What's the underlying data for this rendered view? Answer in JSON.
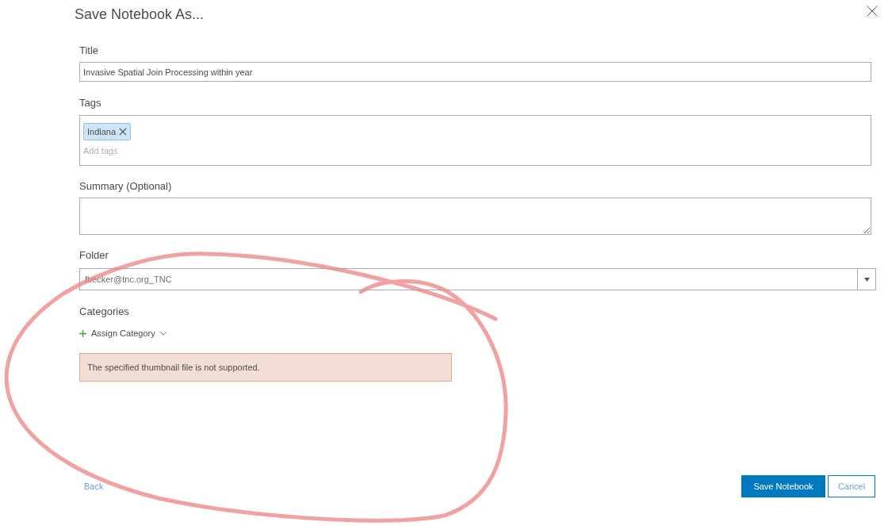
{
  "dialog": {
    "title": "Save Notebook As..."
  },
  "fields": [
    {
      "kind": "text",
      "label": "Title",
      "value": "Invasive Spatial Join Processing within year"
    },
    {
      "kind": "tags",
      "label": "Tags",
      "tags": [
        "Indiana"
      ],
      "placeholder": "Add tags"
    },
    {
      "kind": "textarea",
      "label": "Summary (Optional)"
    },
    {
      "kind": "select",
      "label": "Folder",
      "value": "fbecker@tnc.org_TNC"
    },
    {
      "kind": "categories",
      "label": "Categories",
      "action": "Assign Category"
    }
  ],
  "error": "The specified thumbnail file is not supported.",
  "footer": {
    "back": "Back",
    "primary": "Save Notebook",
    "cancel": "Cancel"
  }
}
